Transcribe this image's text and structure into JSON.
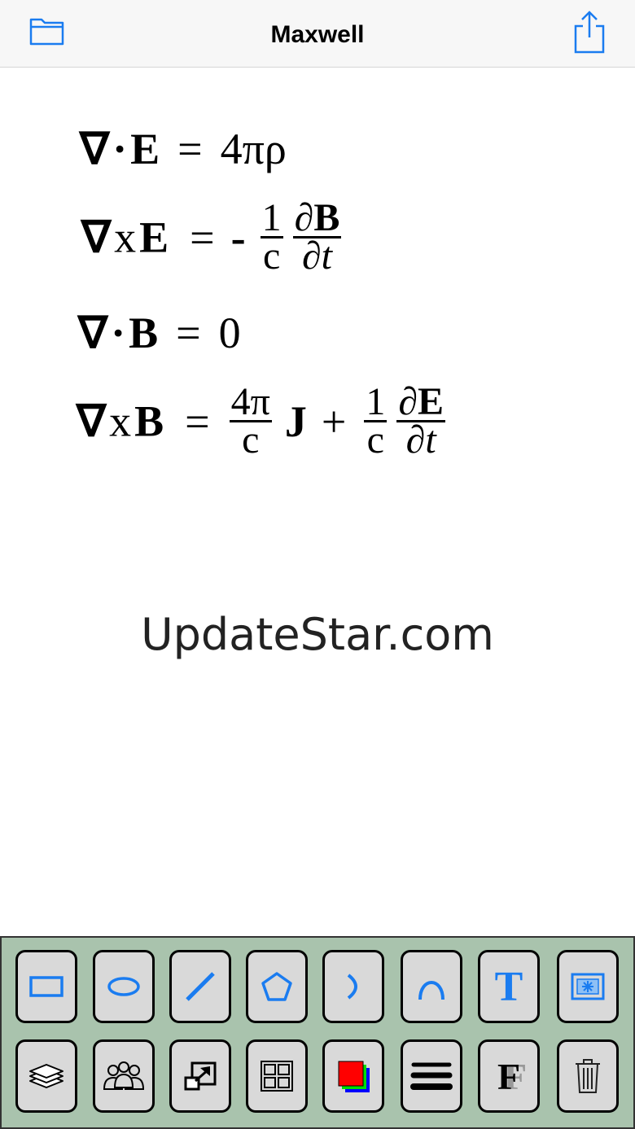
{
  "header": {
    "title": "Maxwell"
  },
  "equations": {
    "eq1": {
      "nabla": "∇",
      "op": "·",
      "field": "E",
      "equals": "=",
      "rhs": "4πρ"
    },
    "eq2": {
      "nabla": "∇",
      "op": "x",
      "field": "E",
      "equals": "=",
      "minus": "-",
      "frac1_num": "1",
      "frac1_den": "c",
      "frac2_num_d": "∂",
      "frac2_num_f": "B",
      "frac2_den": "∂t"
    },
    "eq3": {
      "nabla": "∇",
      "op": "·",
      "field": "B",
      "equals": "=",
      "rhs": "0"
    },
    "eq4": {
      "nabla": "∇",
      "op": "x",
      "field": "B",
      "equals": "=",
      "frac1_num": "4π",
      "frac1_den": "c",
      "J": "J",
      "plus": "+",
      "frac2_num": "1",
      "frac2_den": "c",
      "frac3_num_d": "∂",
      "frac3_num_f": "E",
      "frac3_den": "∂t"
    }
  },
  "watermark": "UpdateStar.com",
  "colors": {
    "accent": "#1a7cf0",
    "toolbar_bg": "#a9c3ad",
    "button_bg": "#d9d9d9"
  },
  "toolbar": {
    "row1": [
      "rectangle-icon",
      "ellipse-icon",
      "line-icon",
      "pentagon-icon",
      "arc-icon",
      "curve-icon",
      "text-icon",
      "image-icon"
    ],
    "row2": [
      "layers-icon",
      "group-icon",
      "resize-icon",
      "grid-icon",
      "color-icon",
      "line-weight-icon",
      "font-icon",
      "trash-icon"
    ],
    "text_glyph": "T",
    "font_glyph": "F"
  }
}
